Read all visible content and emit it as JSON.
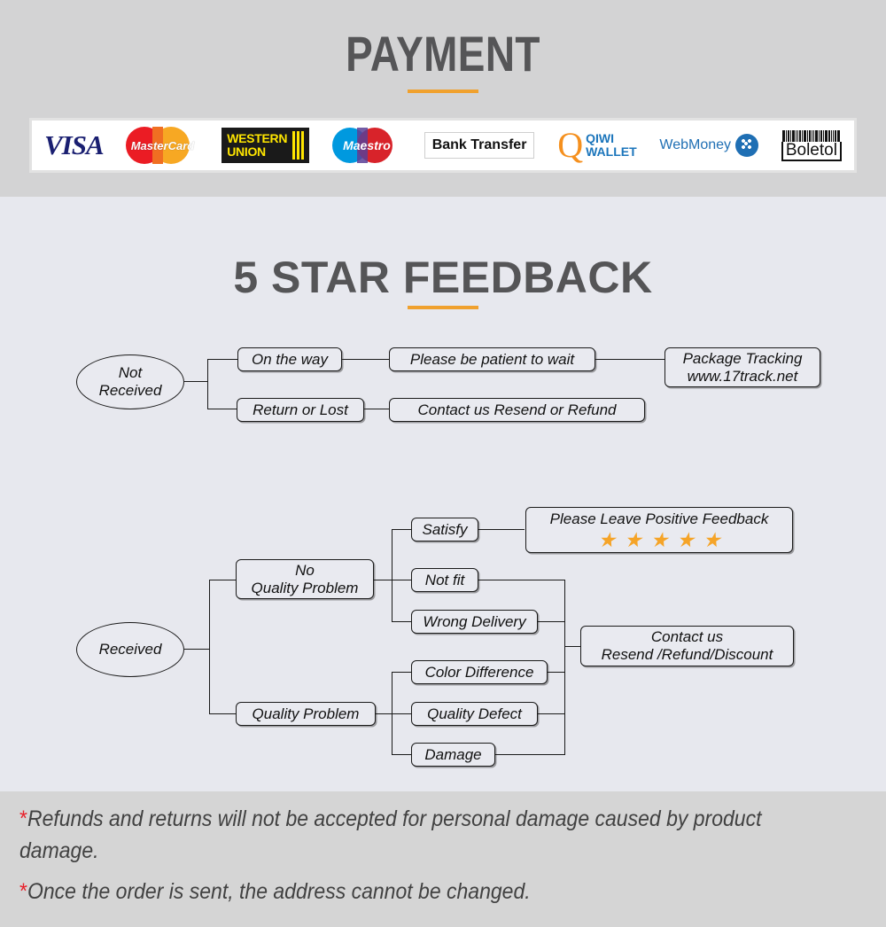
{
  "sections": {
    "payment": {
      "title": "PAYMENT",
      "accent_color": "#f0a12e",
      "background": "#d3d3d4",
      "logos": [
        {
          "name": "visa",
          "label": "VISA"
        },
        {
          "name": "mastercard",
          "label": "MasterCard"
        },
        {
          "name": "western-union",
          "line1": "WESTERN",
          "line2": "UNION"
        },
        {
          "name": "maestro",
          "label": "Maestro"
        },
        {
          "name": "bank-transfer",
          "label": "Bank Transfer"
        },
        {
          "name": "qiwi-wallet",
          "line1": "QIWI",
          "line2": "WALLET"
        },
        {
          "name": "webmoney",
          "label": "WebMoney"
        },
        {
          "name": "boleto",
          "label": "Boletol"
        }
      ]
    },
    "feedback": {
      "title": "5 STAR FEEDBACK",
      "accent_color": "#f0a12e",
      "background": "#e7e8ee",
      "chart_not_received": {
        "root": "Not\nReceived",
        "branch_top": "On the way",
        "branch_top_next": "Please be patient to wait",
        "branch_top_last": "Package Tracking\nwww.17track.net",
        "branch_bottom": "Return or Lost",
        "branch_bottom_next": "Contact us  Resend or Refund"
      },
      "chart_received": {
        "root": "Received",
        "no_quality_problem": "No\nQuality Problem",
        "quality_problem": "Quality Problem",
        "outcomes_no_problem": [
          "Satisfy",
          "Not fit",
          "Wrong Delivery"
        ],
        "outcomes_problem": [
          "Color Difference",
          "Quality  Defect",
          "Damage"
        ],
        "positive_feedback": "Please Leave Positive Feedback",
        "star_count": 5,
        "star_color": "#f5a428",
        "star_glyph": "★",
        "contact": "Contact us\nResend /Refund/Discount"
      }
    },
    "notes": {
      "background": "#d5d5d5",
      "asterisk": "*",
      "asterisk_color": "#e8202a",
      "items": [
        "Refunds and returns will not be accepted for personal damage caused by product damage.",
        "Once the order is sent, the address cannot be changed."
      ]
    }
  }
}
